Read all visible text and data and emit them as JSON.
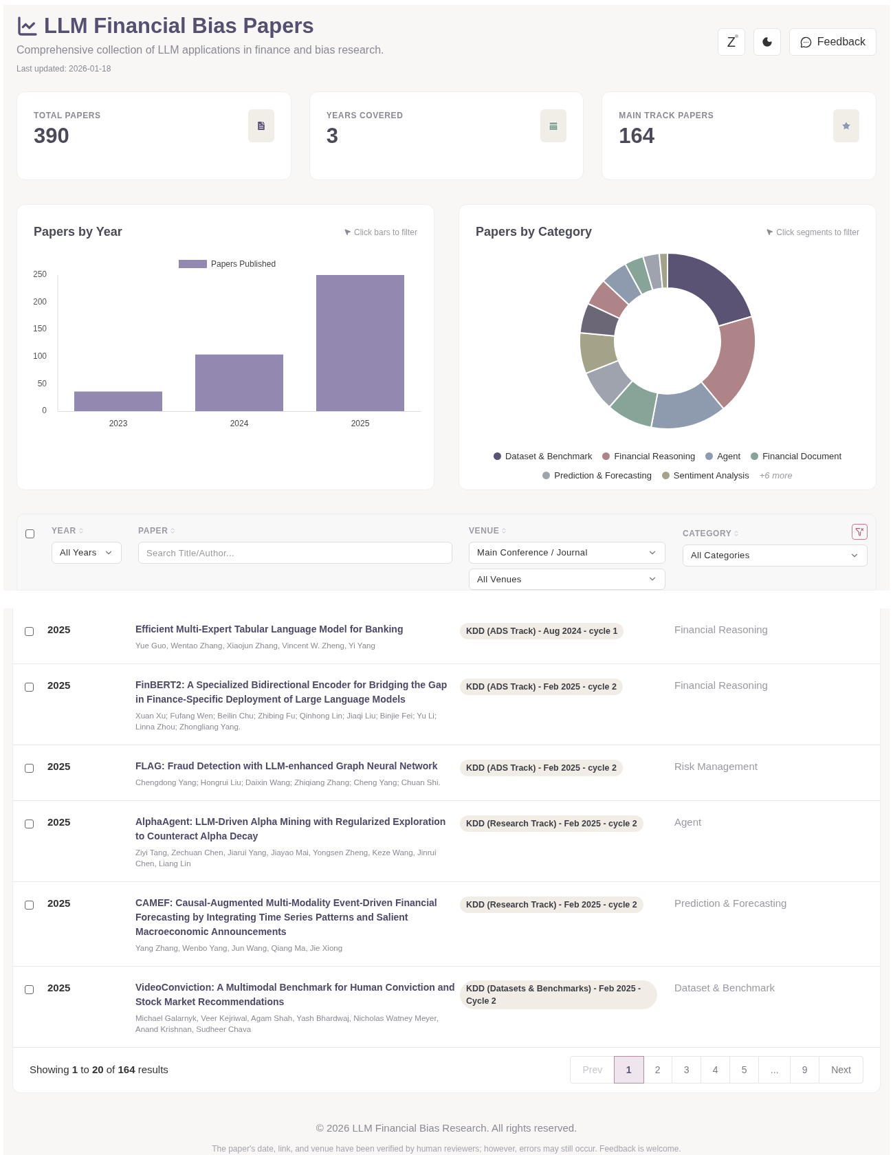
{
  "header": {
    "title": "LLM Financial Bias Papers",
    "subtitle": "Comprehensive collection of LLM applications in finance and bias research.",
    "updated": "Last updated: 2026-01-18",
    "z_button": "Z",
    "feedback_button": "Feedback"
  },
  "stats": [
    {
      "label": "TOTAL PAPERS",
      "value": "390",
      "kind": "file"
    },
    {
      "label": "YEARS COVERED",
      "value": "3",
      "kind": "calendar"
    },
    {
      "label": "MAIN TRACK PAPERS",
      "value": "164",
      "kind": "star"
    }
  ],
  "year_chart": {
    "title": "Papers by Year",
    "hint": "Click bars to filter",
    "chart_data": {
      "type": "bar",
      "categories": [
        "2023",
        "2024",
        "2025"
      ],
      "series": [
        {
          "name": "Papers Published",
          "color": "#9389b0",
          "values": [
            36,
            104,
            250
          ]
        }
      ],
      "ylim": [
        0,
        250
      ],
      "yticks": [
        0,
        50,
        100,
        150,
        200,
        250
      ]
    }
  },
  "category_chart": {
    "title": "Papers by Category",
    "hint": "Click segments to filter",
    "legend": [
      {
        "label": "Dataset & Benchmark",
        "color": "#5b5373"
      },
      {
        "label": "Financial Reasoning",
        "color": "#ae8489"
      },
      {
        "label": "Agent",
        "color": "#8e9aad"
      },
      {
        "label": "Financial Document",
        "color": "#88a498"
      },
      {
        "label": "Prediction & Forecasting",
        "color": "#9ea3ae"
      },
      {
        "label": "Sentiment Analysis",
        "color": "#a4a38a"
      }
    ],
    "more": "+6 more"
  },
  "filters": {
    "select_all": {
      "checked": false
    },
    "year": {
      "label": "YEAR",
      "value": "All Years"
    },
    "paper": {
      "label": "PAPER",
      "placeholder": "Search Title/Author..."
    },
    "venue": {
      "label": "VENUE",
      "type_value": "Main Conference / Journal",
      "value": "All Venues"
    },
    "category": {
      "label": "CATEGORY",
      "value": "All Categories"
    }
  },
  "rows": [
    {
      "checked": false,
      "year": "2025",
      "title": "Efficient Multi-Expert Tabular Language Model for Banking",
      "authors": "Yue Guo, Wentao Zhang, Xiaojun Zhang, Vincent W. Zheng, Yi Yang",
      "venue": "KDD (ADS Track) - Aug 2024 - cycle 1",
      "category": "Financial Reasoning"
    },
    {
      "checked": false,
      "year": "2025",
      "title": "FinBERT2: A Specialized Bidirectional Encoder for Bridging the Gap in Finance-Specific Deployment of Large Language Models",
      "authors": "Xuan Xu; Fufang Wen; Beilin Chu; Zhibing Fu; Qinhong Lin; Jiaqi Liu; Binjie Fei; Yu Li; Linna Zhou; Zhongliang Yang.",
      "venue": "KDD (ADS Track) - Feb 2025 - cycle 2",
      "category": "Financial Reasoning"
    },
    {
      "checked": false,
      "year": "2025",
      "title": "FLAG: Fraud Detection with LLM-enhanced Graph Neural Network",
      "authors": "Chengdong Yang; Hongrui Liu; Daixin Wang; Zhiqiang Zhang; Cheng Yang; Chuan Shi.",
      "venue": "KDD (ADS Track) - Feb 2025 - cycle 2",
      "category": "Risk Management"
    },
    {
      "checked": false,
      "year": "2025",
      "title": "AlphaAgent: LLM-Driven Alpha Mining with Regularized Exploration to Counteract Alpha Decay",
      "authors": "Ziyi Tang, Zechuan Chen, Jiarui Yang, Jiayao Mai, Yongsen Zheng, Keze Wang, Jinrui Chen, Liang Lin",
      "venue": "KDD (Research Track) - Feb 2025 - cycle 2",
      "category": "Agent"
    },
    {
      "checked": false,
      "year": "2025",
      "title": "CAMEF: Causal-Augmented Multi-Modality Event-Driven Financial Forecasting by Integrating Time Series Patterns and Salient Macroeconomic Announcements",
      "authors": "Yang Zhang, Wenbo Yang, Jun Wang, Qiang Ma, Jie Xiong",
      "venue": "KDD (Research Track) - Feb 2025 - cycle 2",
      "category": "Prediction & Forecasting"
    },
    {
      "checked": false,
      "year": "2025",
      "title": "VideoConviction: A Multimodal Benchmark for Human Conviction and Stock Market Recommendations",
      "authors": "Michael Galarnyk, Veer Kejriwal, Agam Shah, Yash Bhardwaj, Nicholas Watney Meyer, Anand Krishnan, Sudheer Chava",
      "venue": "KDD (Datasets & Benchmarks) - Feb 2025 - Cycle 2",
      "category": "Dataset & Benchmark"
    }
  ],
  "results": "Showing **1** to **20** of **164** results",
  "pagination": [
    {
      "label": "Prev",
      "kind": "nav",
      "disabled": true,
      "selected": false
    },
    {
      "label": "1",
      "kind": "page",
      "disabled": false,
      "selected": true
    },
    {
      "label": "2",
      "kind": "page",
      "disabled": false,
      "selected": false
    },
    {
      "label": "3",
      "kind": "page",
      "disabled": false,
      "selected": false
    },
    {
      "label": "4",
      "kind": "page",
      "disabled": false,
      "selected": false
    },
    {
      "label": "5",
      "kind": "page",
      "disabled": false,
      "selected": false
    },
    {
      "label": "...",
      "kind": "gap",
      "disabled": false,
      "selected": false
    },
    {
      "label": "9",
      "kind": "page",
      "disabled": false,
      "selected": false
    },
    {
      "label": "Next",
      "kind": "nav",
      "disabled": false,
      "selected": false
    }
  ],
  "footer": {
    "copyright": "© 2026 LLM Financial Bias Research. All rights reserved.",
    "note": "The paper's date, link, and venue have been verified by human reviewers; however, errors may still occur. Feedback is welcome."
  }
}
